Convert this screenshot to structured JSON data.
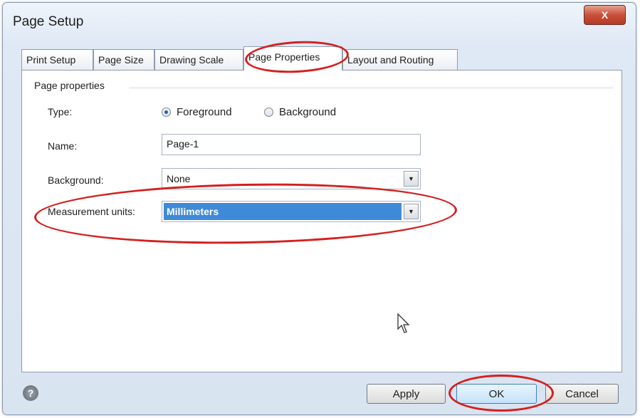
{
  "window": {
    "title": "Page Setup",
    "close_label": "X"
  },
  "tabs": [
    {
      "label": "Print Setup"
    },
    {
      "label": "Page Size"
    },
    {
      "label": "Drawing Scale"
    },
    {
      "label": "Page Properties",
      "active": true
    },
    {
      "label": "Layout and Routing"
    }
  ],
  "page_properties": {
    "group_label": "Page properties",
    "type_label": "Type:",
    "type_options": [
      {
        "label": "Foreground",
        "selected": true
      },
      {
        "label": "Background",
        "selected": false
      }
    ],
    "name_label": "Name:",
    "name_value": "Page-1",
    "background_label": "Background:",
    "background_value": "None",
    "units_label": "Measurement units:",
    "units_value": "Millimeters"
  },
  "buttons": {
    "apply": "Apply",
    "ok": "OK",
    "cancel": "Cancel",
    "help_icon": "?"
  },
  "colors": {
    "annotation_red": "#d42020",
    "selection_blue": "#3f8ad8"
  }
}
